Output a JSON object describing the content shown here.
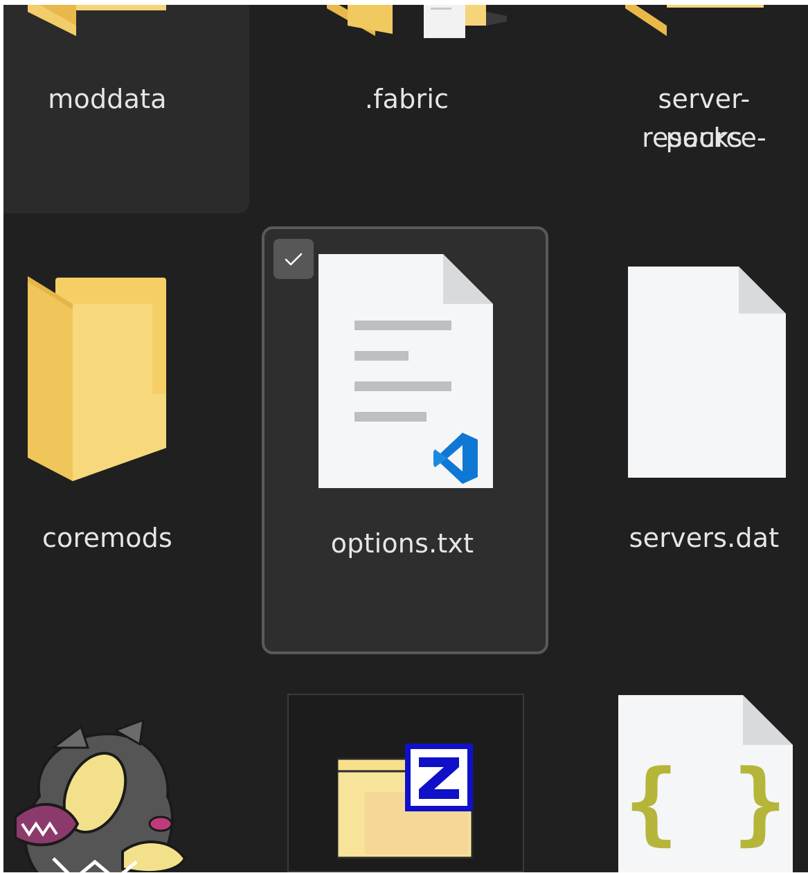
{
  "items": [
    {
      "name": "moddata",
      "type": "folder",
      "state": "hover",
      "icon": "folder-icon"
    },
    {
      "name": ".fabric",
      "type": "folder",
      "state": "normal",
      "icon": "folder-with-documents-icon"
    },
    {
      "name_lines": [
        "server-resource-",
        "packs"
      ],
      "type": "folder",
      "state": "normal",
      "icon": "folder-icon"
    },
    {
      "name": "coremods",
      "type": "folder",
      "state": "normal",
      "icon": "folder-icon"
    },
    {
      "name": "options.txt",
      "type": "file",
      "state": "selected",
      "icon": "vscode-text-file-icon",
      "checked": true
    },
    {
      "name": "servers.dat",
      "type": "file",
      "state": "normal",
      "icon": "blank-file-icon"
    },
    {
      "name": "",
      "type": "file",
      "state": "normal",
      "icon": "character-sprite-icon"
    },
    {
      "name": "",
      "type": "file",
      "state": "normal",
      "icon": "zip-folder-icon"
    },
    {
      "name": "",
      "type": "file",
      "state": "normal",
      "icon": "json-file-icon"
    }
  ],
  "colors": {
    "background": "#202020",
    "folder_yellow": "#f4cf6b",
    "selection_border": "#5a5a5a",
    "vscode_blue": "#0f78d4",
    "json_braces": "#b5b53a"
  }
}
